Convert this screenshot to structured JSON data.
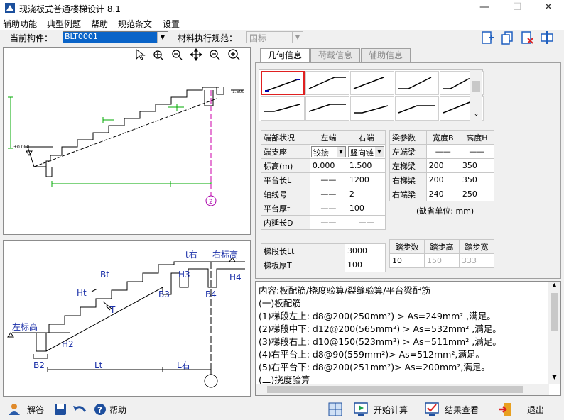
{
  "title": "现浇板式普通楼梯设计 8.1",
  "menu": [
    "辅助功能",
    "典型例题",
    "帮助",
    "规范条文",
    "设置"
  ],
  "toolbar": {
    "component_label": "当前构件：",
    "component_value": "BLT0001",
    "code_label": "材料执行规范：",
    "code_value": "国标"
  },
  "tabs": [
    "几何信息",
    "荷载信息",
    "辅助信息"
  ],
  "ends_table": {
    "headers": [
      "端部状况",
      "左端",
      "右端"
    ],
    "rows": [
      [
        "端支座",
        "铰接",
        "竖向链"
      ],
      [
        "标高(m)",
        "0.000",
        "1.500"
      ],
      [
        "平台长L",
        "——",
        "1200"
      ],
      [
        "轴线号",
        "——",
        "2"
      ],
      [
        "平台厚t",
        "——",
        "100"
      ],
      [
        "内延长D",
        "——",
        "——"
      ]
    ]
  },
  "beam_table": {
    "headers": [
      "梁参数",
      "宽度B",
      "高度H"
    ],
    "rows": [
      [
        "左端梁",
        "——",
        "——"
      ],
      [
        "左梯梁",
        "200",
        "350"
      ],
      [
        "右梯梁",
        "200",
        "350"
      ],
      [
        "右端梁",
        "240",
        "250"
      ]
    ],
    "note": "(缺省单位: mm)"
  },
  "flight_table": {
    "rows": [
      [
        "梯段长Lt",
        "3000"
      ],
      [
        "梯板厚T",
        "100"
      ]
    ]
  },
  "step_table": {
    "headers": [
      "踏步数",
      "踏步高",
      "踏步宽"
    ],
    "values": [
      "10",
      "150",
      "333"
    ]
  },
  "results": [
    "内容:板配筋/挠度验算/裂缝验算/平台梁配筋",
    "(一)板配筋",
    "(1)梯段左上: d8@200(250mm²) > As=249mm² ,满足。",
    "(2)梯段中下: d12@200(565mm²) > As=532mm² ,满足。",
    "(3)梯段右上: d10@150(523mm²) > As=511mm² ,满足。",
    "(4)右平台上: d8@90(559mm²)> As=512mm²,满足。",
    "(5)右平台下: d8@200(251mm²)> As=200mm²,满足。",
    "(二)挠度验算"
  ],
  "diagram_labels": {
    "left_elev": "左标高",
    "right_elev": "右标高",
    "t_right": "t右",
    "Bt": "Bt",
    "Ht": "Ht",
    "T": "T",
    "H2": "H2",
    "H3": "H3",
    "H4": "H4",
    "B2": "B2",
    "B3": "B3",
    "B4": "B4",
    "Lt": "Lt",
    "L_right": "L右"
  },
  "drawing_labels": {
    "elev_left": "±0.000",
    "elev_right": "1.500",
    "axis": "2"
  },
  "bottom": {
    "answer": "解答",
    "help": "帮助",
    "calc": "开始计算",
    "view": "结果查看",
    "exit": "退出"
  }
}
